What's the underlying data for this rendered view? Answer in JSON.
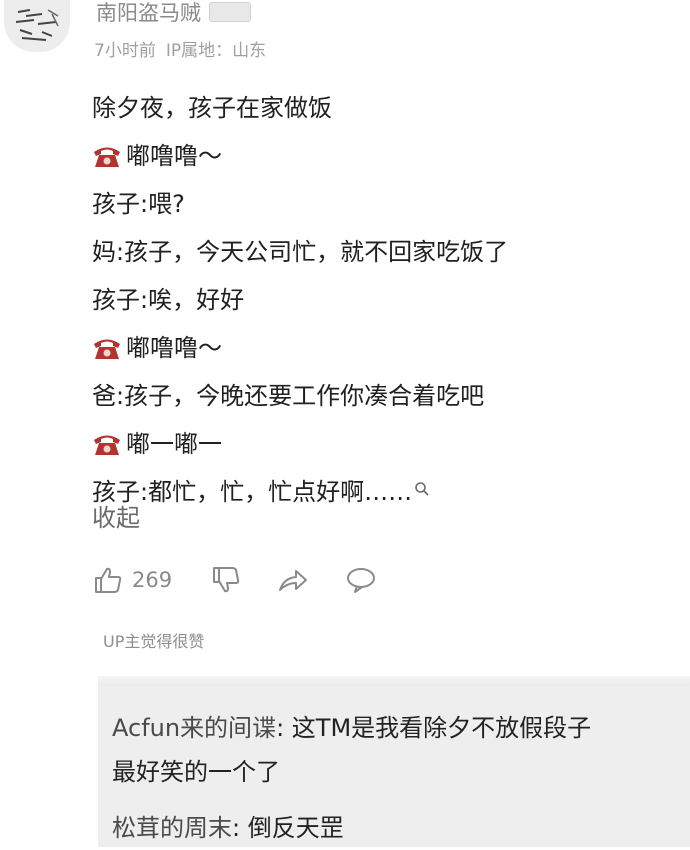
{
  "comment": {
    "username": "南阳盗马贼",
    "time": "7小时前",
    "ip_location": "IP属地：山东",
    "lines": [
      {
        "text": "除夕夜，孩子在家做饭",
        "icon": null
      },
      {
        "text": "嘟噜噜～",
        "icon": "telephone-icon"
      },
      {
        "text": "孩子:喂?",
        "icon": null
      },
      {
        "text": "妈:孩子，今天公司忙，就不回家吃饭了",
        "icon": null
      },
      {
        "text": "孩子:唉，好好",
        "icon": null
      },
      {
        "text": "嘟噜噜～",
        "icon": "telephone-icon"
      },
      {
        "text": "爸:孩子，今晚还要工作你凑合着吃吧",
        "icon": null
      },
      {
        "text": "嘟一嘟一",
        "icon": "telephone-icon"
      },
      {
        "text": "孩子:都忙，忙，忙点好啊……",
        "icon": "search-icon"
      }
    ],
    "collapse_label": "收起",
    "actions": {
      "like_count": "269",
      "like_icon": "thumbs-up-icon",
      "dislike_icon": "thumbs-down-icon",
      "share_icon": "share-icon",
      "reply_icon": "comment-icon"
    },
    "up_tag": "UP主觉得很赞"
  },
  "replies": [
    {
      "name": "Acfun来的间谍",
      "text": "这TM是我看除夕不放假段子",
      "continuation": "最好笑的一个了"
    },
    {
      "name": "松茸的周末",
      "text": "倒反天罡"
    }
  ],
  "colors": {
    "phone_red": "#b5322f",
    "meta_gray": "#a0a0a0",
    "reply_bg": "#eeeeee"
  }
}
